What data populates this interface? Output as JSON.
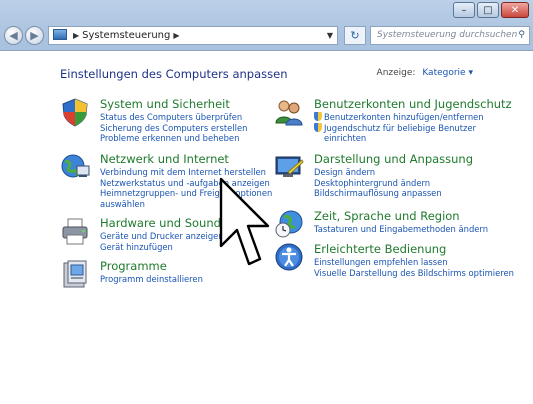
{
  "window": {
    "caption_buttons": [
      "minimize",
      "maximize",
      "close"
    ]
  },
  "address": {
    "breadcrumb": "Systemsteuerung",
    "search_placeholder": "Systemsteuerung durchsuchen"
  },
  "main": {
    "heading": "Einstellungen des Computers anpassen",
    "view_label": "Anzeige:",
    "view_value": "Kategorie"
  },
  "categories": [
    {
      "title": "System und Sicherheit",
      "icon": "shield-icon",
      "links": [
        "Status des Computers überprüfen",
        "Sicherung des Computers erstellen",
        "Probleme erkennen und beheben"
      ]
    },
    {
      "title": "Netzwerk und Internet",
      "icon": "network-icon",
      "links": [
        "Verbindung mit dem Internet herstellen",
        "Netzwerkstatus und -aufgaben anzeigen",
        "Heimnetzgruppen- und Freigabeoptionen",
        "auswählen"
      ]
    },
    {
      "title": "Hardware und Sound",
      "icon": "printer-icon",
      "links": [
        "Geräte und Drucker anzeigen",
        "Gerät hinzufügen"
      ]
    },
    {
      "title": "Programme",
      "icon": "programs-icon",
      "links": [
        "Programm deinstallieren"
      ]
    },
    {
      "title": "Benutzerkonten und Jugendschutz",
      "icon": "users-icon",
      "links": [
        "Benutzerkonten hinzufügen/entfernen",
        "Jugendschutz für beliebige Benutzer",
        "einrichten"
      ]
    },
    {
      "title": "Darstellung und Anpassung",
      "icon": "display-icon",
      "links": [
        "Design ändern",
        "Desktophintergrund ändern",
        "Bildschirmauflösung anpassen"
      ]
    },
    {
      "title": "Zeit, Sprache und Region",
      "icon": "globe-clock-icon",
      "links": [
        "Tastaturen und Eingabemethoden ändern"
      ]
    },
    {
      "title": "Erleichterte Bedienung",
      "icon": "accessibility-icon",
      "links": [
        "Einstellungen empfehlen lassen",
        "Visuelle Darstellung des Bildschirms optimieren"
      ]
    }
  ]
}
